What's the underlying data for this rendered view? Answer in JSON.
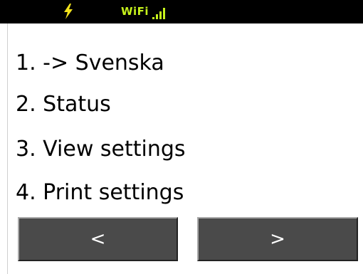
{
  "status_bar": {
    "power_icon": "lightning-bolt-icon",
    "wifi_label": "WiFi",
    "signal_icon": "signal-bars-icon",
    "background_color": "#000000",
    "icon_color": "#c6f21c",
    "bolt_color": "#f2e21c"
  },
  "menu": {
    "items": [
      {
        "label": "1. -> Svenska"
      },
      {
        "label": "2. Status"
      },
      {
        "label": "3. View settings"
      },
      {
        "label": "4. Print settings"
      }
    ]
  },
  "navigation": {
    "prev_label": "<",
    "next_label": ">",
    "button_color": "#4a4a4a"
  }
}
